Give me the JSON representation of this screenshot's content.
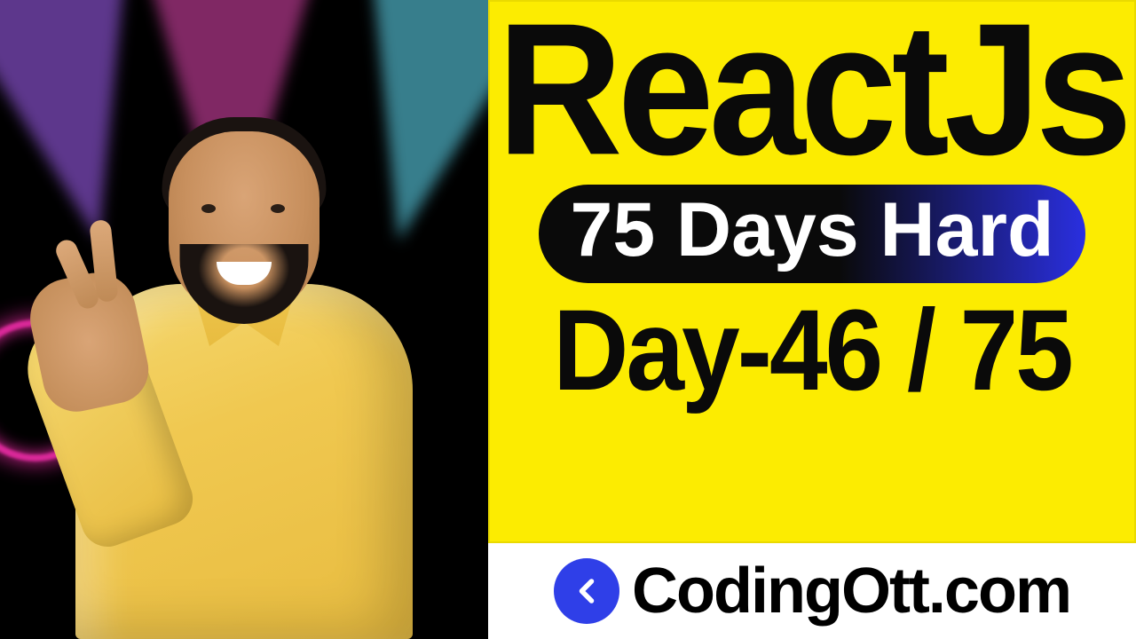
{
  "thumbnail": {
    "title": "ReactJs",
    "badge": "75 Days Hard",
    "day_line": "Day-46 / 75",
    "brand": "CodingOtt.com"
  },
  "colors": {
    "yellow": "#fcec01",
    "pill_gradient_start": "#0a0a0a",
    "pill_gradient_end": "#2a2fe0",
    "logo": "#2f3fe8"
  }
}
